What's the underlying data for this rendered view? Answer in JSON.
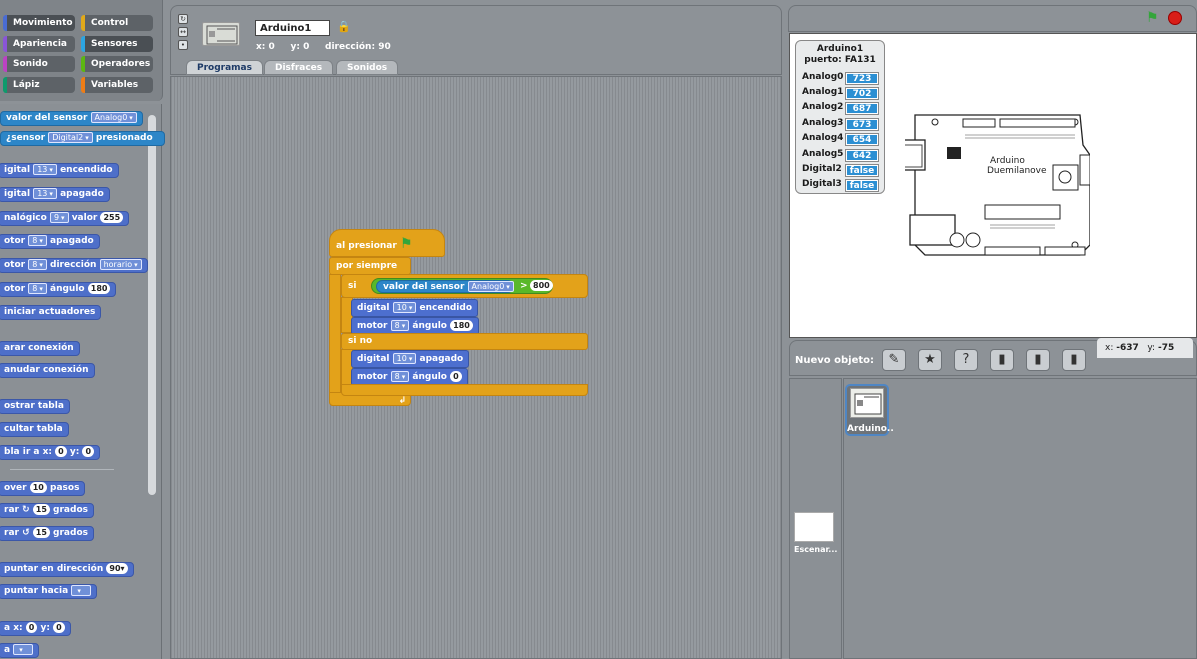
{
  "categories": [
    {
      "label": "Movimiento",
      "color": "#4a6cd4"
    },
    {
      "label": "Control",
      "color": "#e1a91a"
    },
    {
      "label": "Apariencia",
      "color": "#8a55d7"
    },
    {
      "label": "Sensores",
      "color": "#2ca5e2"
    },
    {
      "label": "Sonido",
      "color": "#bb42c3"
    },
    {
      "label": "Operadores",
      "color": "#5cb712"
    },
    {
      "label": "Lápiz",
      "color": "#0e9a6c"
    },
    {
      "label": "Variables",
      "color": "#ee7d16"
    }
  ],
  "palette": {
    "sensor_value": {
      "label": "valor del sensor",
      "slot": "Analog0"
    },
    "sensor_pressed": {
      "pre": "¿sensor",
      "slot": "Digital2",
      "post": "presionado"
    },
    "b1": {
      "a": "igital",
      "slot": "13",
      "b": "encendido"
    },
    "b2": {
      "a": "igital",
      "slot": "13",
      "b": "apagado"
    },
    "b3": {
      "a": "nalógico",
      "slot": "9",
      "b": "valor",
      "num": "255"
    },
    "b4": {
      "a": "otor",
      "slot": "8",
      "b": "apagado"
    },
    "b5": {
      "a": "otor",
      "slot": "8",
      "b": "dirección",
      "slot2": "horario"
    },
    "b6": {
      "a": "otor",
      "slot": "8",
      "b": "ángulo",
      "num": "180"
    },
    "b7": "iniciar actuadores",
    "b8": "arar conexión",
    "b9": "anudar conexión",
    "b10": "ostrar tabla",
    "b11": "cultar tabla",
    "b12": {
      "a": "bla ir a x:",
      "num1": "0",
      "b": "y:",
      "num2": "0"
    },
    "b13": {
      "a": "over",
      "num": "10",
      "b": "pasos"
    },
    "b14": {
      "a": "rar ↻",
      "num": "15",
      "b": "grados"
    },
    "b15": {
      "a": "rar ↺",
      "num": "15",
      "b": "grados"
    },
    "b16": {
      "a": "puntar en dirección",
      "num": "90▾"
    },
    "b17": "puntar hacia",
    "b18": {
      "a": "a x:",
      "num1": "0",
      "b": "y:",
      "num2": "0"
    },
    "b19": "a"
  },
  "sprite": {
    "name": "Arduino1",
    "x_label": "x:",
    "x": "0",
    "y_label": "y:",
    "y": "0",
    "dir_label": "dirección:",
    "dir": "90"
  },
  "tabs": [
    "Programas",
    "Disfraces",
    "Sonidos"
  ],
  "script": {
    "hat": "al presionar",
    "forever": "por siempre",
    "if": "si",
    "cond_label": "valor del sensor",
    "cond_slot": "Analog0",
    "cond_op": ">",
    "cond_val": "800",
    "then1": {
      "a": "digital",
      "slot": "10",
      "b": "encendido"
    },
    "then2": {
      "a": "motor",
      "slot": "8",
      "b": "ángulo",
      "num": "180"
    },
    "else": "si no",
    "else1": {
      "a": "digital",
      "slot": "10",
      "b": "apagado"
    },
    "else2": {
      "a": "motor",
      "slot": "8",
      "b": "ángulo",
      "num": "0"
    }
  },
  "sensor_board": {
    "title": "Arduino1",
    "port": "puerto: FA131",
    "rows": [
      {
        "name": "Analog0",
        "value": "723"
      },
      {
        "name": "Analog1",
        "value": "702"
      },
      {
        "name": "Analog2",
        "value": "687"
      },
      {
        "name": "Analog3",
        "value": "673"
      },
      {
        "name": "Analog4",
        "value": "654"
      },
      {
        "name": "Analog5",
        "value": "642"
      },
      {
        "name": "Digital2",
        "value": "false"
      },
      {
        "name": "Digital3",
        "value": "false"
      }
    ]
  },
  "board_text": {
    "l1": "Arduino",
    "l2": "Duemilanove"
  },
  "sprites_pane": {
    "nuevo": "Nuevo objeto:",
    "mouse_x_label": "x:",
    "mouse_x": "-637",
    "mouse_y_label": "y:",
    "mouse_y": "-75",
    "sprite_label": "Arduino..",
    "stage_label": "Escenar..."
  }
}
